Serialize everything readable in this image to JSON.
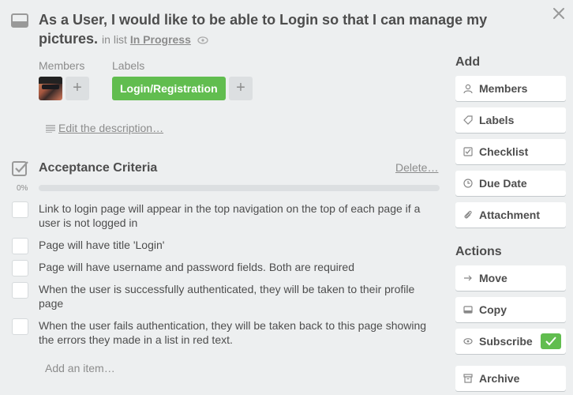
{
  "card": {
    "title": "As a User, I would like to be able to Login so that I can manage my pictures.",
    "in_list_prefix": "in list",
    "list_name": "In Progress"
  },
  "members": {
    "heading": "Members"
  },
  "labels": {
    "heading": "Labels",
    "chip": "Login/Registration",
    "chip_color": "#61bd4f"
  },
  "description": {
    "link": "Edit the description…"
  },
  "checklist": {
    "title": "Acceptance Criteria",
    "delete": "Delete…",
    "percent": "0%",
    "progress": 0,
    "items": [
      {
        "text": "Link to login page will appear in the top navigation on the top of each page if a user is not logged in"
      },
      {
        "text": "Page will have title 'Login'"
      },
      {
        "text": "Page will have username and password fields. Both are required"
      },
      {
        "text": "When the user is successfully authenticated, they will be taken to their profile page"
      },
      {
        "text": "When the user fails authentication, they will be taken back to this page showing the errors they made in a list in red text."
      }
    ],
    "add_item": "Add an item…"
  },
  "sidebar": {
    "add_heading": "Add",
    "add_buttons": [
      {
        "label": "Members",
        "icon": "person-icon"
      },
      {
        "label": "Labels",
        "icon": "tag-icon"
      },
      {
        "label": "Checklist",
        "icon": "checkbox-icon"
      },
      {
        "label": "Due Date",
        "icon": "clock-icon"
      },
      {
        "label": "Attachment",
        "icon": "paperclip-icon"
      }
    ],
    "actions_heading": "Actions",
    "action_buttons": [
      {
        "label": "Move",
        "icon": "arrow-right-icon"
      },
      {
        "label": "Copy",
        "icon": "card-icon"
      },
      {
        "label": "Subscribe",
        "icon": "eye-icon"
      },
      {
        "label": "Archive",
        "icon": "archive-icon"
      }
    ]
  },
  "colors": {
    "accent_green": "#61bd4f",
    "background": "#edeff0"
  }
}
